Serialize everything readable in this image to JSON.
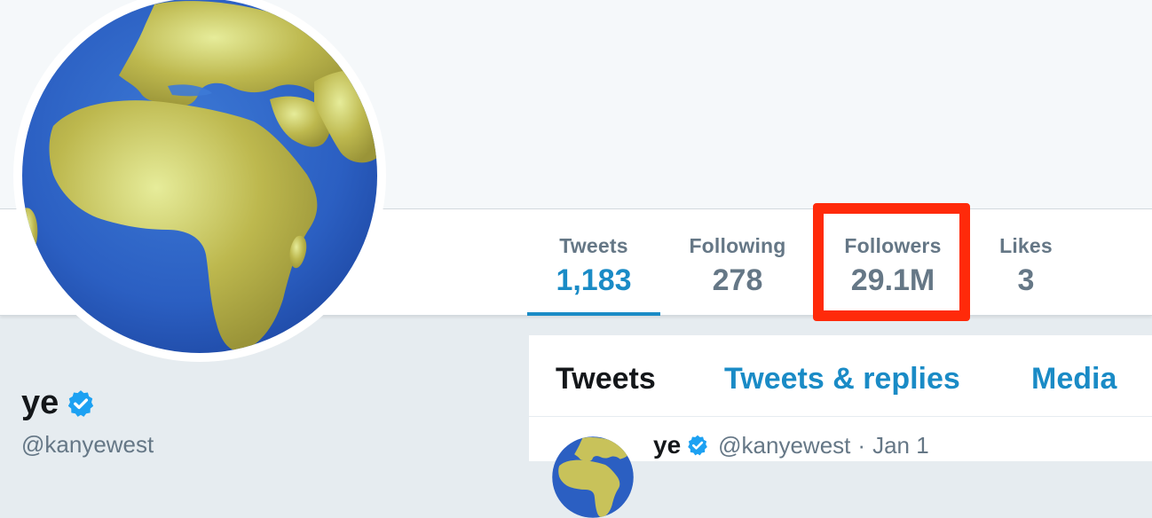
{
  "profile": {
    "name": "ye",
    "handle": "@kanyewest"
  },
  "stats": [
    {
      "label": "Tweets",
      "value": "1,183"
    },
    {
      "label": "Following",
      "value": "278"
    },
    {
      "label": "Followers",
      "value": "29.1M"
    },
    {
      "label": "Likes",
      "value": "3"
    }
  ],
  "timeline": {
    "tabs": [
      "Tweets",
      "Tweets & replies",
      "Media"
    ]
  },
  "tweet": {
    "name": "ye",
    "handle": "@kanyewest",
    "separator": "·",
    "time": "Jan 1"
  },
  "icons": {
    "avatar": "globe-europe-africa-icon",
    "verified": "verified-badge-icon"
  },
  "colors": {
    "accent": "#1a8bc6",
    "highlight": "#ff2a0a",
    "muted": "#657786",
    "text": "#14171a",
    "verified": "#1da1f2"
  }
}
